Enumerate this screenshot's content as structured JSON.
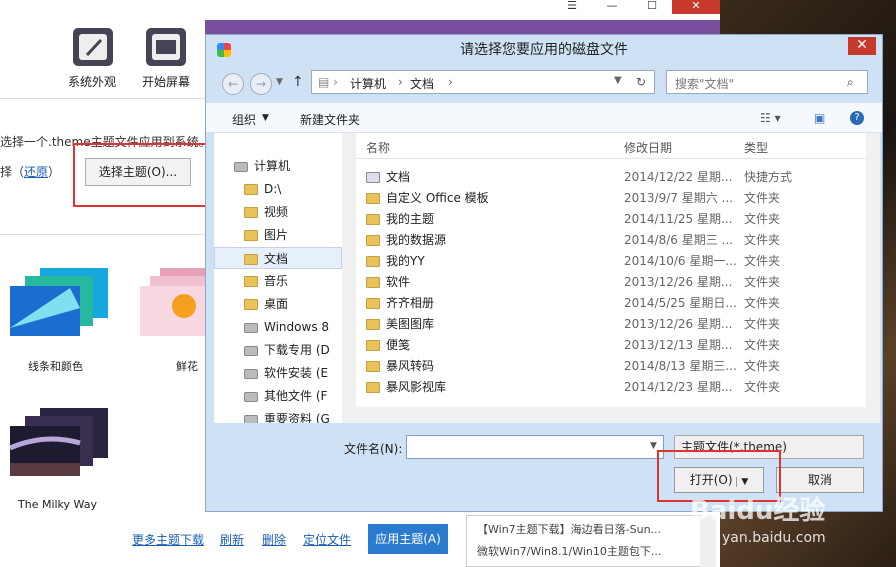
{
  "app": {
    "top_items": [
      {
        "label": "系统外观",
        "icon": "brush-icon"
      },
      {
        "label": "开始屏幕",
        "icon": "grid-icon"
      }
    ],
    "hint_text": "选择一个.theme主题文件应用到系统。",
    "restore_prefix": "择（",
    "restore_link": "还原",
    "restore_suffix": "）",
    "choose_theme_button": "选择主题(O)...",
    "themes": [
      {
        "label": "线条和颜色"
      },
      {
        "label": "鲜花"
      },
      {
        "label": "The Milky Way"
      }
    ],
    "bottom_links": [
      "更多主题下载",
      "刷新",
      "删除",
      "定位文件"
    ],
    "apply_button": "应用主题(A)",
    "news": [
      "【Win7主题下载】海边看日落-Sun...",
      "微软Win7/Win8.1/Win10主题包下..."
    ]
  },
  "dialog": {
    "title": "请选择您要应用的磁盘文件",
    "breadcrumb": [
      "计算机",
      "文档"
    ],
    "search_placeholder": "搜索\"文档\"",
    "toolbar": {
      "organize": "组织",
      "new_folder": "新建文件夹"
    },
    "tree": [
      {
        "label": "计算机",
        "type": "computer"
      },
      {
        "label": "D:\\",
        "type": "folder"
      },
      {
        "label": "视频",
        "type": "folder"
      },
      {
        "label": "图片",
        "type": "folder"
      },
      {
        "label": "文档",
        "type": "folder",
        "selected": true
      },
      {
        "label": "音乐",
        "type": "folder"
      },
      {
        "label": "桌面",
        "type": "folder"
      },
      {
        "label": "Windows 8",
        "type": "drive"
      },
      {
        "label": "下载专用 (D",
        "type": "drive"
      },
      {
        "label": "软件安装 (E",
        "type": "drive"
      },
      {
        "label": "其他文件 (F",
        "type": "drive"
      },
      {
        "label": "重要资料 (G",
        "type": "drive"
      }
    ],
    "columns": {
      "name": "名称",
      "date": "修改日期",
      "type": "类型"
    },
    "files": [
      {
        "name": "文档",
        "date": "2014/12/22 星期...",
        "type": "快捷方式"
      },
      {
        "name": "自定义 Office 模板",
        "date": "2013/9/7 星期六 ...",
        "type": "文件夹"
      },
      {
        "name": "我的主题",
        "date": "2014/11/25 星期...",
        "type": "文件夹"
      },
      {
        "name": "我的数据源",
        "date": "2014/8/6 星期三 ...",
        "type": "文件夹"
      },
      {
        "name": "我的YY",
        "date": "2014/10/6 星期一...",
        "type": "文件夹"
      },
      {
        "name": "软件",
        "date": "2013/12/26 星期...",
        "type": "文件夹"
      },
      {
        "name": "齐齐相册",
        "date": "2014/5/25 星期日...",
        "type": "文件夹"
      },
      {
        "name": "美图图库",
        "date": "2013/12/26 星期...",
        "type": "文件夹"
      },
      {
        "name": "便笺",
        "date": "2013/12/13 星期...",
        "type": "文件夹"
      },
      {
        "name": "暴风转码",
        "date": "2014/8/13 星期三...",
        "type": "文件夹"
      },
      {
        "name": "暴风影视库",
        "date": "2014/12/23 星期...",
        "type": "文件夹"
      }
    ],
    "filename_label": "文件名(N):",
    "filename_value": "",
    "filetype": "主题文件(*.theme)",
    "open_button": "打开(O)",
    "cancel_button": "取消"
  },
  "watermark": {
    "brand": "Baidu经验",
    "url": "yan.baidu.com"
  },
  "colors": {
    "accent": "#2a7bd0",
    "highlight_red": "#d33333",
    "close_red": "#c8392c"
  }
}
